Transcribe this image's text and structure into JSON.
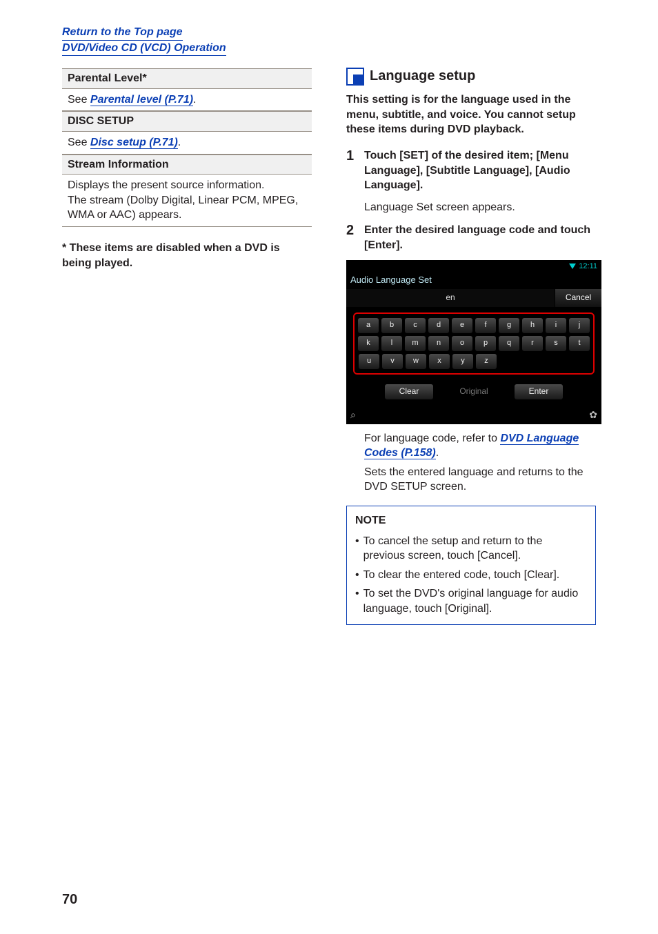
{
  "top_links": {
    "return": "Return to the Top page",
    "section": "DVD/Video CD (VCD) Operation"
  },
  "left": {
    "rows": [
      {
        "head": "Parental Level*",
        "prefix": "See ",
        "link": "Parental level (P.71)",
        "suffix": "."
      },
      {
        "head": "DISC SETUP",
        "prefix": "See ",
        "link": "Disc setup (P.71)",
        "suffix": "."
      },
      {
        "head": "Stream Information",
        "body": "Displays the present source information.\nThe stream (Dolby Digital, Linear PCM, MPEG, WMA or AAC) appears."
      }
    ],
    "footnote": "* These items are disabled when a DVD is being played."
  },
  "right": {
    "title": "Language setup",
    "intro": "This setting is for the language used in the menu, subtitle, and voice. You cannot setup these items during DVD playback.",
    "steps": [
      {
        "num": "1",
        "title": "Touch [SET] of the desired item; [Menu Language], [Subtitle Language], [Audio Language].",
        "sub": "Language Set screen appears."
      },
      {
        "num": "2",
        "title": "Enter the desired language code and touch [Enter]."
      }
    ],
    "device": {
      "clock": "12:11",
      "screen_title": "Audio Language Set",
      "input_value": "en",
      "cancel": "Cancel",
      "keys_row1": [
        "a",
        "b",
        "c",
        "d",
        "e",
        "f",
        "g",
        "h",
        "i",
        "j"
      ],
      "keys_row2": [
        "k",
        "l",
        "m",
        "n",
        "o",
        "p",
        "q",
        "r",
        "s",
        "t"
      ],
      "keys_row3": [
        "u",
        "v",
        "w",
        "x",
        "y",
        "z"
      ],
      "clear": "Clear",
      "original": "Original",
      "enter": "Enter",
      "loupe": "⌕",
      "gear": "✿"
    },
    "after_device": {
      "p1_prefix": "For language code, refer to ",
      "p1_link": "DVD Language Codes (P.158)",
      "p1_suffix": ".",
      "p2": "Sets the entered language and returns to the DVD SETUP screen."
    },
    "note": {
      "title": "NOTE",
      "items": [
        "To cancel the setup and return to the previous screen, touch [Cancel].",
        "To clear the entered code, touch [Clear].",
        "To set the DVD's original language for audio language, touch [Original]."
      ]
    }
  },
  "page_number": "70"
}
